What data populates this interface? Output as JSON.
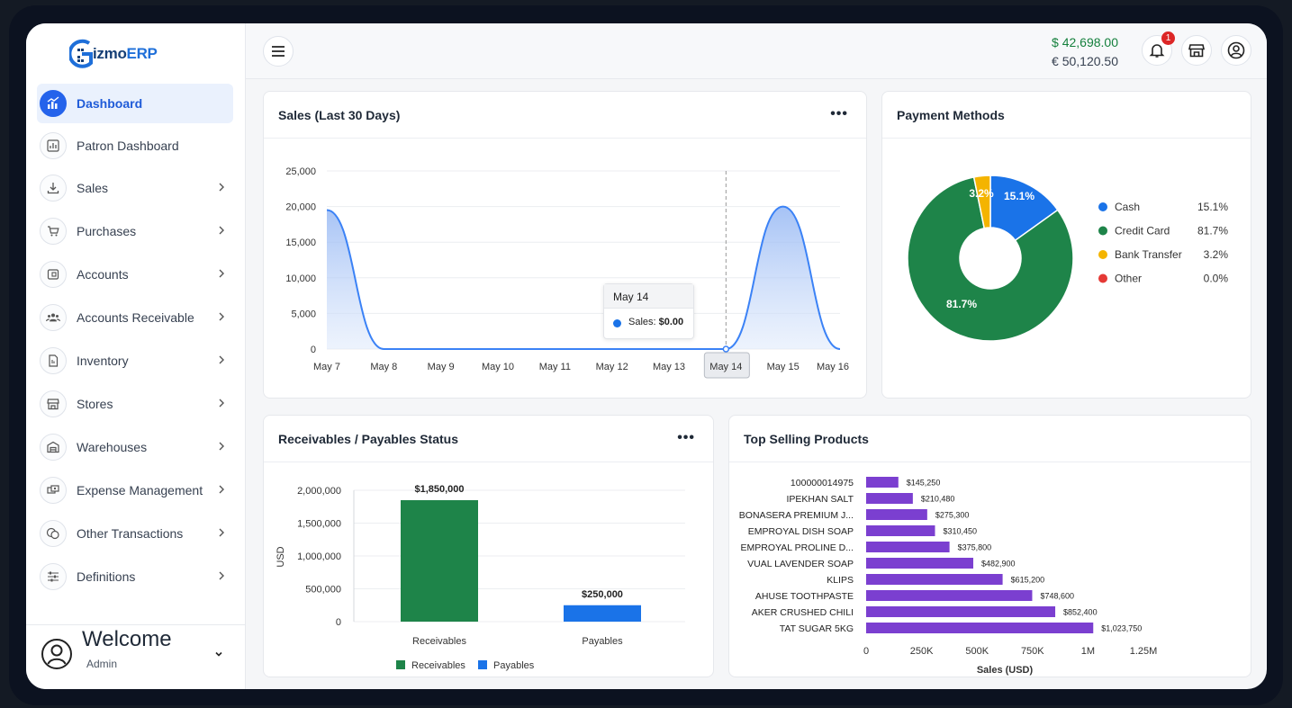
{
  "brand": {
    "name_main": "izmo",
    "name_accent": "ERP"
  },
  "sidebar": {
    "items": [
      {
        "label": "Dashboard"
      },
      {
        "label": "Patron Dashboard"
      },
      {
        "label": "Sales"
      },
      {
        "label": "Purchases"
      },
      {
        "label": "Accounts"
      },
      {
        "label": "Accounts Receivable"
      },
      {
        "label": "Inventory"
      },
      {
        "label": "Stores"
      },
      {
        "label": "Warehouses"
      },
      {
        "label": "Expense Management"
      },
      {
        "label": "Other Transactions"
      },
      {
        "label": "Definitions"
      }
    ],
    "welcome": "Welcome",
    "role": "Admin"
  },
  "header": {
    "balance_usd": "$ 42,698.00",
    "balance_eur": "€ 50,120.50",
    "notification_count": "1"
  },
  "sales_card": {
    "title": "Sales (Last 30 Days)",
    "tooltip": {
      "date": "May 14",
      "label": "Sales:",
      "value": "$0.00"
    }
  },
  "payment_card": {
    "title": "Payment Methods"
  },
  "recv_card": {
    "title": "Receivables / Payables Status"
  },
  "top_card": {
    "title": "Top Selling Products"
  },
  "colors": {
    "primary": "#2563eb",
    "sales_line": "#3b82f6",
    "receivables": "#1e8449",
    "payables": "#1a73e8",
    "bar_purple": "#7b3fd0",
    "cash": "#1a73e8",
    "credit_card": "#1e8449",
    "bank_transfer": "#f4b400",
    "other": "#e53935"
  },
  "chart_data": [
    {
      "id": "sales",
      "type": "area",
      "categories": [
        "May 7",
        "May 8",
        "May 9",
        "May 10",
        "May 11",
        "May 12",
        "May 13",
        "May 14",
        "May 15",
        "May 16"
      ],
      "series": [
        {
          "name": "Sales",
          "values": [
            19500,
            0,
            0,
            0,
            0,
            0,
            0,
            0,
            20000,
            0
          ]
        }
      ],
      "ylim": [
        0,
        25000
      ],
      "yticks": [
        "25,000",
        "20,000",
        "15,000",
        "10,000",
        "5,000",
        "0"
      ],
      "highlight": "May 14"
    },
    {
      "id": "payment",
      "type": "pie",
      "labels": [
        "Cash",
        "Credit Card",
        "Bank Transfer",
        "Other"
      ],
      "values": [
        15.1,
        81.7,
        3.2,
        0.0
      ],
      "display": [
        "15.1%",
        "81.7%",
        "3.2%",
        "0.0%"
      ],
      "legend": "right"
    },
    {
      "id": "receivables",
      "type": "bar",
      "categories": [
        "Receivables",
        "Payables"
      ],
      "values": [
        1850000,
        250000
      ],
      "data_labels": [
        "$1,850,000",
        "$250,000"
      ],
      "ylabel": "USD",
      "ylim": [
        0,
        2000000
      ],
      "yticks": [
        "2,000,000",
        "1,500,000",
        "1,000,000",
        "500,000",
        "0"
      ],
      "legend_items": [
        "Receivables",
        "Payables"
      ],
      "legend": "bottom"
    },
    {
      "id": "top_products",
      "type": "bar",
      "orientation": "horizontal",
      "categories": [
        "100000014975",
        "IPEKHAN SALT",
        "BONASERA PREMIUM J...",
        "EMPROYAL DISH SOAP",
        "EMPROYAL PROLINE D...",
        "VUAL LAVENDER SOAP",
        "KLIPS",
        "AHUSE TOOTHPASTE",
        "AKER CRUSHED CHILI",
        "TAT SUGAR 5KG"
      ],
      "values": [
        145250,
        210480,
        275300,
        310450,
        375800,
        482900,
        615200,
        748600,
        852400,
        1023750
      ],
      "data_labels": [
        "$145,250",
        "$210,480",
        "$275,300",
        "$310,450",
        "$375,800",
        "$482,900",
        "$615,200",
        "$748,600",
        "$852,400",
        "$1,023,750"
      ],
      "xlabel": "Sales (USD)",
      "xlim": [
        0,
        1250000
      ],
      "xticks": [
        "0",
        "250K",
        "500K",
        "750K",
        "1M",
        "1.25M"
      ]
    }
  ]
}
